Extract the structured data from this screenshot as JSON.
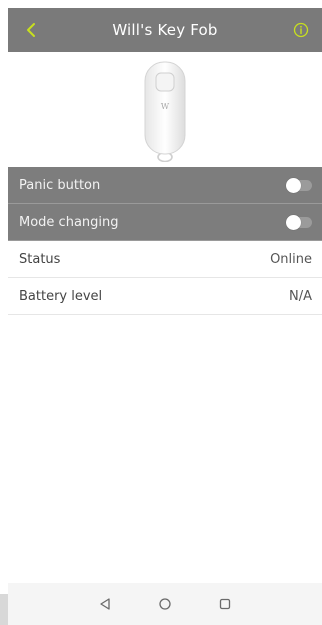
{
  "header": {
    "title": "Will's Key Fob",
    "back_icon": "chevron-left-icon",
    "info_icon": "info-circle-icon",
    "accent_color": "#c8e01e",
    "background_color": "#7a7a7a"
  },
  "device": {
    "image": "key-fob-image",
    "logo_text": "W"
  },
  "settings": [
    {
      "label": "Panic button",
      "type": "toggle",
      "state": "off"
    },
    {
      "label": "Mode changing",
      "type": "toggle",
      "state": "off"
    }
  ],
  "info_rows": [
    {
      "label": "Status",
      "value": "Online"
    },
    {
      "label": "Battery level",
      "value": "N/A"
    }
  ],
  "navbar": {
    "back_icon": "triangle-back-icon",
    "home_icon": "circle-home-icon",
    "recents_icon": "square-recents-icon"
  }
}
